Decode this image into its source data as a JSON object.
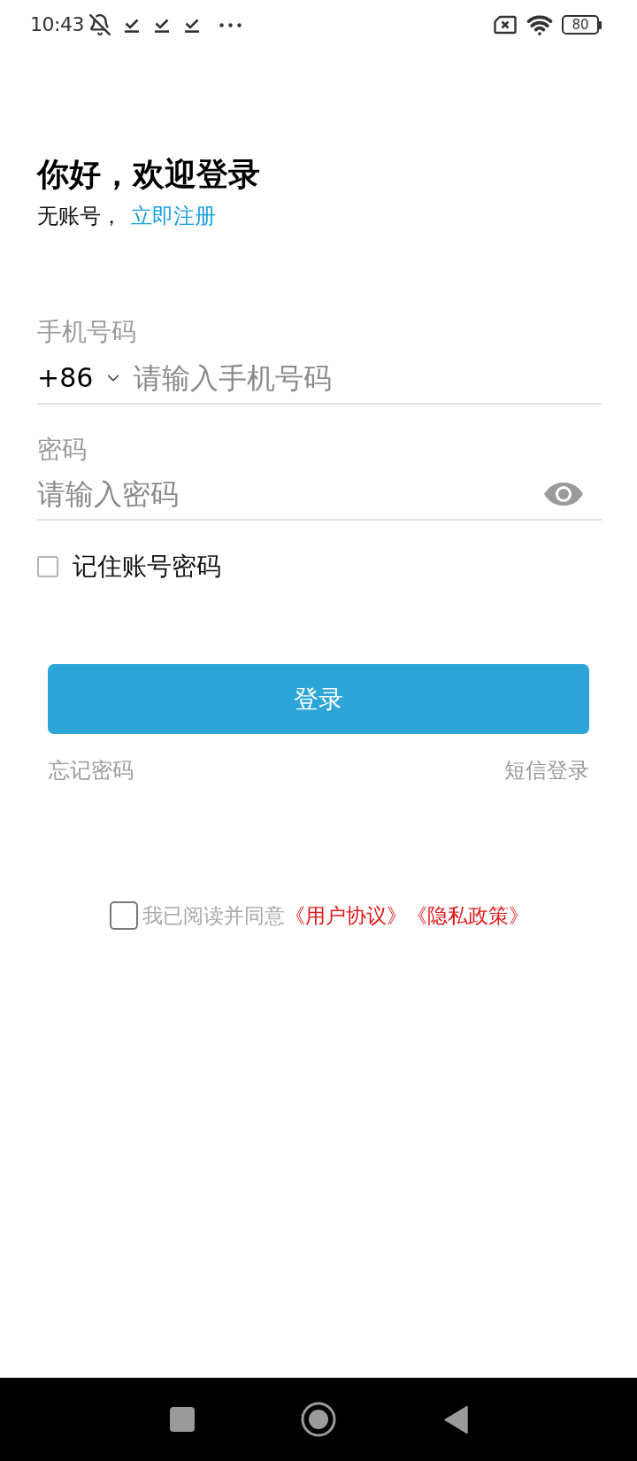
{
  "status_bar": {
    "time": "10:43",
    "battery": "80"
  },
  "header": {
    "title": "你好，欢迎登录",
    "prompt": "无账号，",
    "register_link": "立即注册"
  },
  "phone": {
    "label": "手机号码",
    "country_code": "+86",
    "placeholder": "请输入手机号码"
  },
  "password": {
    "label": "密码",
    "placeholder": "请输入密码"
  },
  "remember": {
    "label": "记住账号密码",
    "checked": false
  },
  "login_button": "登录",
  "links": {
    "forgot_password": "忘记密码",
    "sms_login": "短信登录"
  },
  "agreement": {
    "checked": false,
    "text": "我已阅读并同意",
    "links": [
      "《用户协议》",
      "《隐私政策》"
    ]
  }
}
